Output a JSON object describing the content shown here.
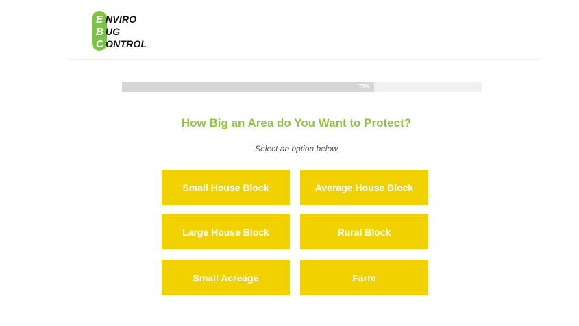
{
  "logo": {
    "rows": [
      {
        "initial": "E",
        "rest": "NVIRO"
      },
      {
        "initial": "B",
        "rest": "UG"
      },
      {
        "initial": "C",
        "rest": "ONTROL"
      }
    ],
    "accent_color": "#7cc243"
  },
  "progress": {
    "percent": 70,
    "label": "70%"
  },
  "question": {
    "title": "How Big an Area do You Want to Protect?",
    "subtitle": "Select an option below"
  },
  "options": [
    {
      "label": "Small House Block"
    },
    {
      "label": "Average House Block"
    },
    {
      "label": "Large House Block"
    },
    {
      "label": "Rural Block"
    },
    {
      "label": "Small Acreage"
    },
    {
      "label": "Farm"
    }
  ],
  "colors": {
    "brand_green": "#8cc63f",
    "button_yellow": "#f2d100"
  }
}
